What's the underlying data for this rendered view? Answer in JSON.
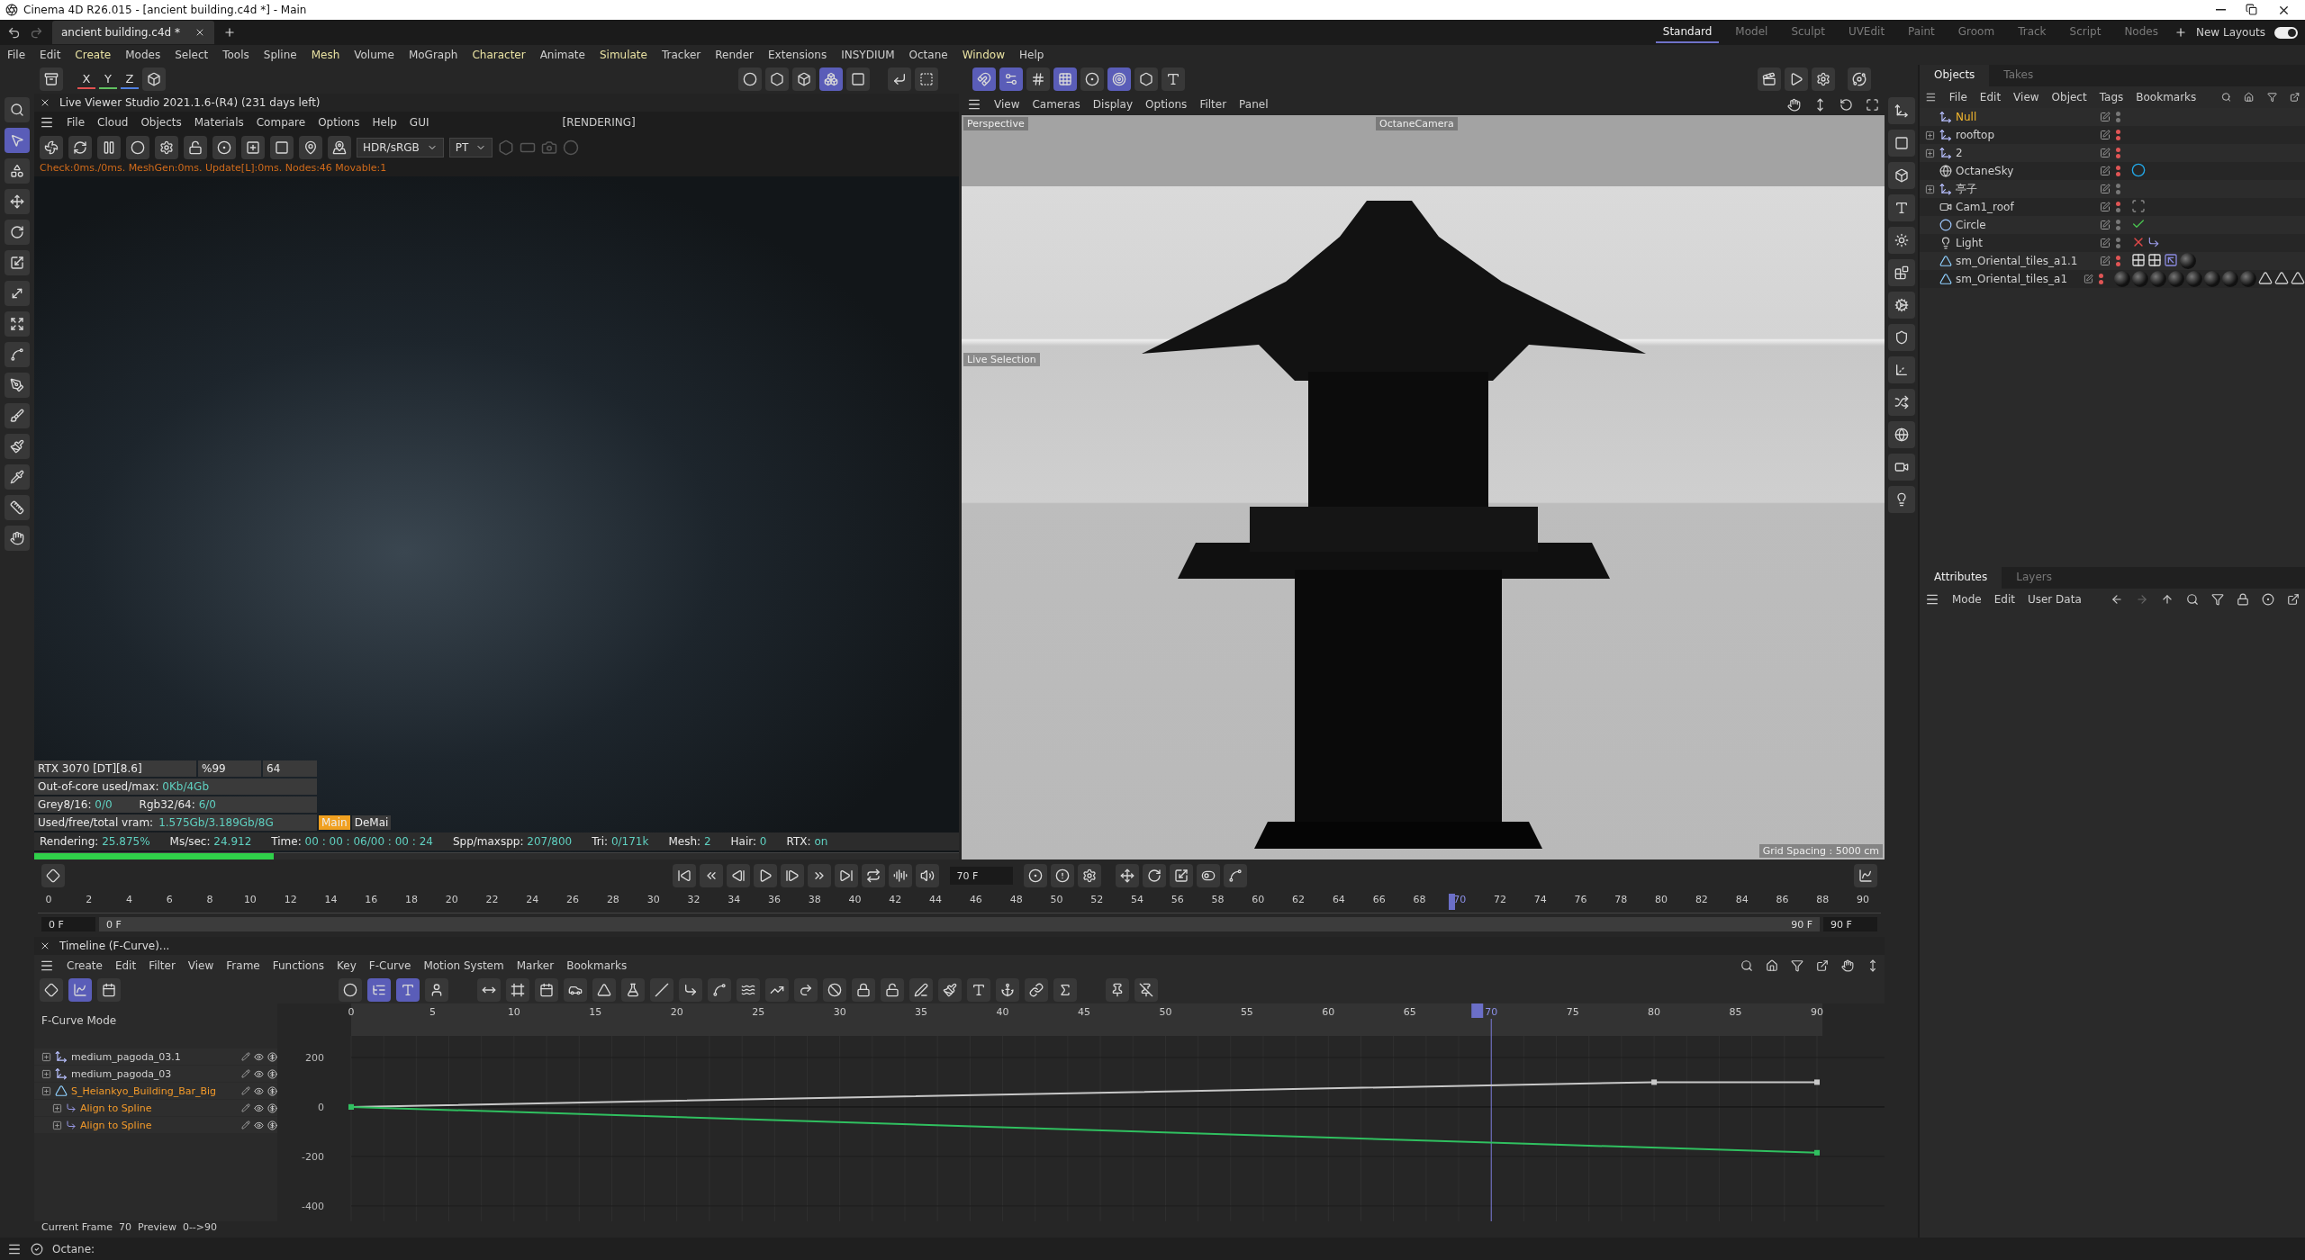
{
  "window": {
    "title": "Cinema 4D R26.015 - [ancient building.c4d *] - Main"
  },
  "document_tab": {
    "label": "ancient building.c4d *"
  },
  "layouts": [
    {
      "label": "Standard",
      "selected": true
    },
    {
      "label": "Model",
      "selected": false
    },
    {
      "label": "Sculpt",
      "selected": false
    },
    {
      "label": "UVEdit",
      "selected": false
    },
    {
      "label": "Paint",
      "selected": false
    },
    {
      "label": "Groom",
      "selected": false
    },
    {
      "label": "Track",
      "selected": false
    },
    {
      "label": "Script",
      "selected": false
    },
    {
      "label": "Nodes",
      "selected": false
    }
  ],
  "new_layouts": {
    "label": "New Layouts",
    "on": true
  },
  "menu": [
    {
      "label": "File",
      "highlighted": false
    },
    {
      "label": "Edit",
      "highlighted": false
    },
    {
      "label": "Create",
      "highlighted": true
    },
    {
      "label": "Modes",
      "highlighted": false
    },
    {
      "label": "Select",
      "highlighted": false
    },
    {
      "label": "Tools",
      "highlighted": false
    },
    {
      "label": "Spline",
      "highlighted": false
    },
    {
      "label": "Mesh",
      "highlighted": true
    },
    {
      "label": "Volume",
      "highlighted": false
    },
    {
      "label": "MoGraph",
      "highlighted": false
    },
    {
      "label": "Character",
      "highlighted": true
    },
    {
      "label": "Animate",
      "highlighted": false
    },
    {
      "label": "Simulate",
      "highlighted": true
    },
    {
      "label": "Tracker",
      "highlighted": false
    },
    {
      "label": "Render",
      "highlighted": false
    },
    {
      "label": "Extensions",
      "highlighted": false
    },
    {
      "label": "INSYDIUM",
      "highlighted": false
    },
    {
      "label": "Octane",
      "highlighted": false
    },
    {
      "label": "Window",
      "highlighted": true
    },
    {
      "label": "Help",
      "highlighted": false
    }
  ],
  "axis_locks": [
    {
      "label": "X",
      "color": "#e05050"
    },
    {
      "label": "Y",
      "color": "#60c060"
    },
    {
      "label": "Z",
      "color": "#5080e0"
    }
  ],
  "mode_tools": [
    {
      "active": false
    },
    {
      "active": false
    },
    {
      "active": false
    },
    {
      "active": true
    },
    {
      "active": false
    }
  ],
  "snap_tools": [
    {
      "active": true
    },
    {
      "active": true
    },
    {
      "active": false
    },
    {
      "active": true
    },
    {
      "active": false
    },
    {
      "active": true
    },
    {
      "active": false
    },
    {
      "active": false
    }
  ],
  "left_tools": [
    {
      "active": false
    },
    {
      "active": true
    },
    {
      "active": false
    },
    {
      "active": false
    },
    {
      "active": false
    },
    {
      "active": false
    },
    {
      "active": false
    },
    {
      "active": false
    },
    {
      "active": false
    },
    {
      "active": false
    },
    {
      "active": false
    },
    {
      "active": false
    },
    {
      "active": false
    },
    {
      "active": false
    },
    {
      "active": false
    }
  ],
  "live_viewer": {
    "title": "Live Viewer Studio 2021.1.6-(R4) (231 days left)",
    "menu": [
      "File",
      "Cloud",
      "Objects",
      "Materials",
      "Compare",
      "Options",
      "Help",
      "GUI"
    ],
    "status": "[RENDERING]",
    "color_mode": "HDR/sRGB",
    "kernel": "PT",
    "log": "Check:0ms./0ms. MeshGen:0ms. Update[L]:0ms. Nodes:46 Movable:1",
    "gpu": [
      "RTX 3070 [DT][8.6]",
      "%99",
      "64"
    ],
    "info_rows": [
      [
        {
          "label": "Out-of-core used/max:",
          "value": "0Kb/4Gb"
        }
      ],
      [
        {
          "label": "Grey8/16:",
          "value": "0/0"
        },
        {
          "label": "Rgb32/64:",
          "value": "6/0"
        }
      ]
    ],
    "vram": {
      "label": "Used/free/total vram:",
      "value": "1.575Gb/3.189Gb/8G"
    },
    "tabs": [
      {
        "label": "Main",
        "selected": true
      },
      {
        "label": "DeMai",
        "selected": false
      }
    ],
    "stats": [
      {
        "label": "Rendering:",
        "value": "25.875%"
      },
      {
        "label": "Ms/sec:",
        "value": "24.912"
      },
      {
        "label": "Time:",
        "value": "00 : 00 : 06/00 : 00 : 24"
      },
      {
        "label": "Spp/maxspp:",
        "value": "207/800"
      },
      {
        "label": "Tri:",
        "value": "0/171k"
      },
      {
        "label": "Mesh:",
        "value": "2"
      },
      {
        "label": "Hair:",
        "value": "0"
      },
      {
        "label": "RTX:",
        "value": "on"
      }
    ],
    "progress": {
      "level": 0.259
    }
  },
  "viewport": {
    "menu": [
      "View",
      "Cameras",
      "Display",
      "Options",
      "Filter",
      "Panel"
    ],
    "view_name": "Perspective",
    "camera": "OctaneCamera",
    "tool_hint": "Live Selection",
    "grid_spacing": "Grid Spacing : 5000 cm"
  },
  "objects_panel": {
    "tabs": [
      {
        "label": "Objects",
        "selected": true
      },
      {
        "label": "Takes",
        "selected": false
      }
    ],
    "menu": [
      "File",
      "Edit",
      "View",
      "Object",
      "Tags",
      "Bookmarks"
    ],
    "rows": [
      {
        "name": "Null",
        "kind": "null",
        "expandable": false,
        "selected": true,
        "visibility": [
          {
            "color": "#777777"
          },
          {
            "color": "#777777"
          }
        ],
        "tags": []
      },
      {
        "name": "rooftop",
        "kind": "null",
        "expandable": true,
        "selected": false,
        "visibility": [
          {
            "color": "#e05555"
          },
          {
            "color": "#e05555"
          }
        ],
        "tags": []
      },
      {
        "name": "2",
        "kind": "null",
        "expandable": true,
        "selected": false,
        "visibility": [
          {
            "color": "#e05555"
          },
          {
            "color": "#e05555"
          }
        ],
        "tags": []
      },
      {
        "name": "OctaneSky",
        "kind": "sky",
        "expandable": false,
        "selected": false,
        "visibility": [
          {
            "color": "#e05555"
          },
          {
            "color": "#e05555"
          }
        ],
        "tags": [
          {
            "kind": "sky"
          }
        ]
      },
      {
        "name": "亭子",
        "kind": "null",
        "expandable": true,
        "selected": false,
        "visibility": [
          {
            "color": "#777777"
          },
          {
            "color": "#777777"
          }
        ],
        "tags": []
      },
      {
        "name": "Cam1_roof",
        "kind": "camera",
        "expandable": false,
        "selected": false,
        "visibility": [
          {
            "color": "#e05555"
          },
          {
            "color": "#777777"
          }
        ],
        "tags": [
          {
            "kind": "target"
          }
        ]
      },
      {
        "name": "Circle",
        "kind": "circle",
        "expandable": false,
        "selected": false,
        "visibility": [
          {
            "color": "#777777"
          },
          {
            "color": "#777777"
          }
        ],
        "tags": [
          {
            "kind": "check"
          }
        ]
      },
      {
        "name": "Light",
        "kind": "light",
        "expandable": false,
        "selected": false,
        "visibility": [
          {
            "color": "#777777"
          },
          {
            "color": "#777777"
          }
        ],
        "tags": [
          {
            "kind": "cross"
          },
          {
            "kind": "layer"
          }
        ]
      },
      {
        "name": "sm_Oriental_tiles_a1.1",
        "kind": "mesh",
        "expandable": false,
        "selected": false,
        "visibility": [
          {
            "color": "#e05555"
          },
          {
            "color": "#e05555"
          }
        ],
        "tags": [
          {
            "kind": "checker"
          },
          {
            "kind": "checker"
          },
          {
            "kind": "uvw"
          },
          {
            "kind": "material"
          }
        ]
      },
      {
        "name": "sm_Oriental_tiles_a1",
        "kind": "mesh",
        "expandable": false,
        "selected": false,
        "visibility": [
          {
            "color": "#e05555"
          },
          {
            "color": "#e05555"
          }
        ],
        "tags": [
          {
            "kind": "material"
          },
          {
            "kind": "material"
          },
          {
            "kind": "material"
          },
          {
            "kind": "material"
          },
          {
            "kind": "material"
          },
          {
            "kind": "material"
          },
          {
            "kind": "material"
          },
          {
            "kind": "material"
          },
          {
            "kind": "triangle"
          },
          {
            "kind": "triangle"
          },
          {
            "kind": "triangle"
          }
        ]
      }
    ]
  },
  "attributes_panel": {
    "tabs": [
      {
        "label": "Attributes",
        "selected": true
      },
      {
        "label": "Layers",
        "selected": false
      }
    ],
    "menu": [
      "Mode",
      "Edit",
      "User Data"
    ]
  },
  "timeline_ruler": {
    "ticks": [
      "0",
      "2",
      "4",
      "6",
      "8",
      "10",
      "12",
      "14",
      "16",
      "18",
      "20",
      "22",
      "24",
      "26",
      "28",
      "30",
      "32",
      "34",
      "36",
      "38",
      "40",
      "42",
      "44",
      "46",
      "48",
      "50",
      "52",
      "54",
      "56",
      "58",
      "60",
      "62",
      "64",
      "66",
      "68",
      "70",
      "72",
      "74",
      "76",
      "78",
      "80",
      "82",
      "84",
      "86",
      "88",
      "90"
    ],
    "playhead": {
      "level": 0.7778
    },
    "current_frame": "70 F",
    "start": "0 F",
    "preview_start": "0 F",
    "preview_end": "90 F",
    "end": "90 F"
  },
  "timeline": {
    "title": "Timeline (F-Curve)...",
    "menu": [
      "Create",
      "Edit",
      "Filter",
      "View",
      "Frame",
      "Functions",
      "Key",
      "F-Curve",
      "Motion System",
      "Marker",
      "Bookmarks"
    ],
    "mode_label": "F-Curve Mode",
    "tracks": [
      {
        "name": "medium_pagoda_03.1",
        "kind": "null",
        "highlighted": false
      },
      {
        "name": "medium_pagoda_03",
        "kind": "null",
        "highlighted": false
      },
      {
        "name": "S_Heiankyo_Building_Bar_Big",
        "kind": "mesh",
        "highlighted": true,
        "children": [
          {
            "name": "Align to Spline",
            "kind": "tag",
            "highlighted": true
          },
          {
            "name": "Align to Spline",
            "kind": "tag",
            "highlighted": true
          }
        ]
      }
    ],
    "chart_data": {
      "type": "line",
      "x": [
        0,
        80,
        90
      ],
      "series": [
        {
          "color": "#c8c8c8",
          "marker": "square",
          "values": [
            0,
            100,
            100
          ]
        },
        {
          "color": "#30c060",
          "marker": "square",
          "values": [
            0,
            null,
            -185
          ]
        }
      ],
      "xlim": [
        0,
        90
      ],
      "ylim": [
        -462,
        287
      ],
      "xticks": [
        0,
        5,
        10,
        15,
        20,
        25,
        30,
        35,
        40,
        45,
        50,
        55,
        60,
        65,
        70,
        75,
        80,
        85,
        90
      ],
      "yticks": [
        200,
        0,
        -200,
        -400
      ],
      "grid": true,
      "ref_lines": [
        {
          "axis": "x",
          "value": 70,
          "color": "#7a7ad8"
        }
      ]
    },
    "footer": "Current Frame  70  Preview  0-->90"
  },
  "status_bar": {
    "text": "Octane:"
  }
}
